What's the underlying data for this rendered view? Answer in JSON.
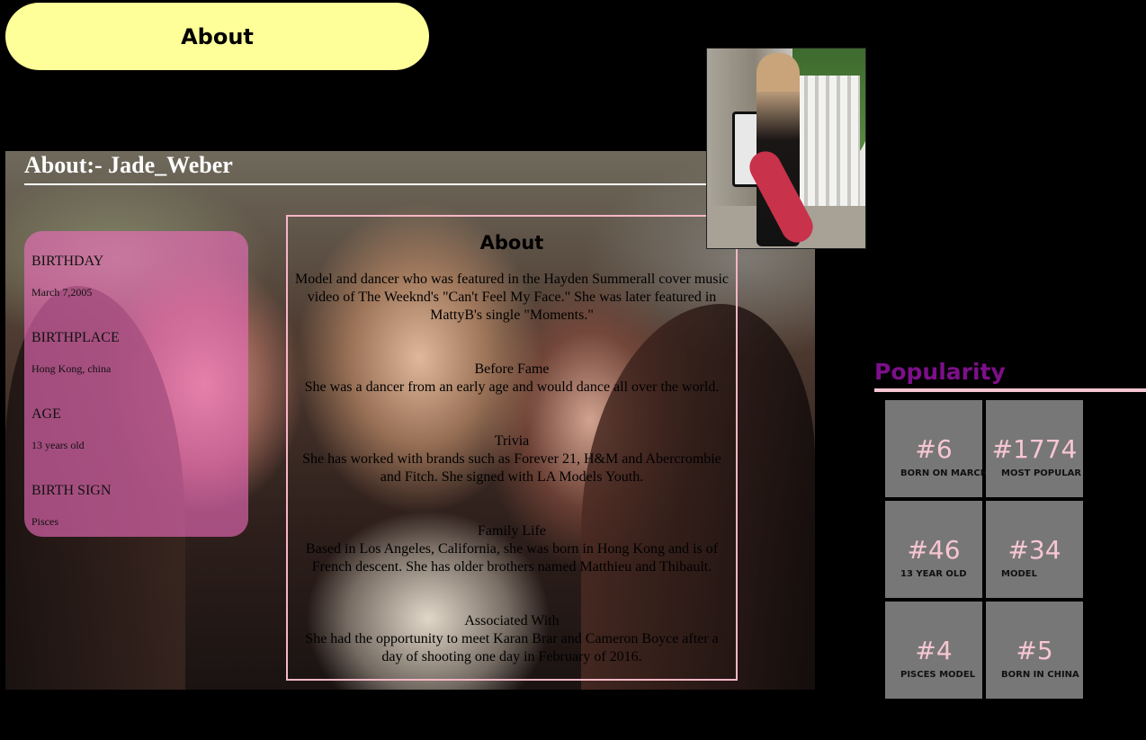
{
  "header": {
    "about_button": "About"
  },
  "profile": {
    "heading": "About:- Jade_Weber"
  },
  "info": [
    {
      "label": "BIRTHDAY",
      "value": "March 7,2005"
    },
    {
      "label": "BIRTHPLACE",
      "value": "Hong Kong, china"
    },
    {
      "label": "AGE",
      "value": "13 years old"
    },
    {
      "label": "BIRTH SIGN",
      "value": "Pisces"
    }
  ],
  "about": {
    "title": "About",
    "sections": [
      {
        "heading": "",
        "text": "Model and dancer who was featured in the Hayden Summerall cover music video of The Weeknd's \"Can't Feel My Face.\" She was later featured in MattyB's single \"Moments.\""
      },
      {
        "heading": "Before Fame",
        "text": "She was a dancer from an early age and would dance all over the world."
      },
      {
        "heading": "Trivia",
        "text": "She has worked with brands such as Forever 21, H&M and Abercrombie and Fitch. She signed with LA Models Youth."
      },
      {
        "heading": "Family Life",
        "text": "Based in Los Angeles, California, she was born in Hong Kong and is of French descent. She has older brothers named Matthieu and Thibault."
      },
      {
        "heading": "Associated With",
        "text": "She had the opportunity to meet Karan Brar and Cameron Boyce after a day of shooting one day in February of 2016."
      }
    ]
  },
  "popularity": {
    "title": "Popularity",
    "tiles": [
      {
        "rank": "#6",
        "caption": "BORN ON MARCH"
      },
      {
        "rank": "#1774",
        "caption": "MOST POPULAR"
      },
      {
        "rank": "#46",
        "caption": "13 YEAR OLD"
      },
      {
        "rank": "#34",
        "caption": "MODEL"
      },
      {
        "rank": "#4",
        "caption": "PISCES MODEL"
      },
      {
        "rank": "#5",
        "caption": "BORN IN CHINA"
      }
    ]
  },
  "colors": {
    "background": "#000000",
    "about_button": "#ffff99",
    "info_card": "#f06ebe",
    "popularity_title": "#7d0f8a",
    "accent_pink": "#f7c6d3",
    "tile": "#777777"
  }
}
